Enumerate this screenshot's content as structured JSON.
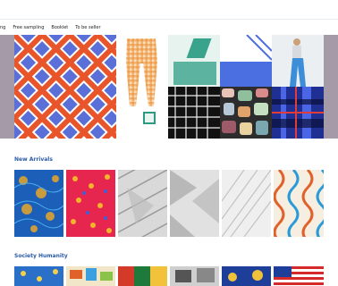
{
  "nav": {
    "items": [
      "ng",
      "Free sampling",
      "Booklet",
      "To be seller"
    ]
  },
  "sections": [
    {
      "title": "New Arrivals"
    },
    {
      "title": "Society Humanity"
    }
  ]
}
